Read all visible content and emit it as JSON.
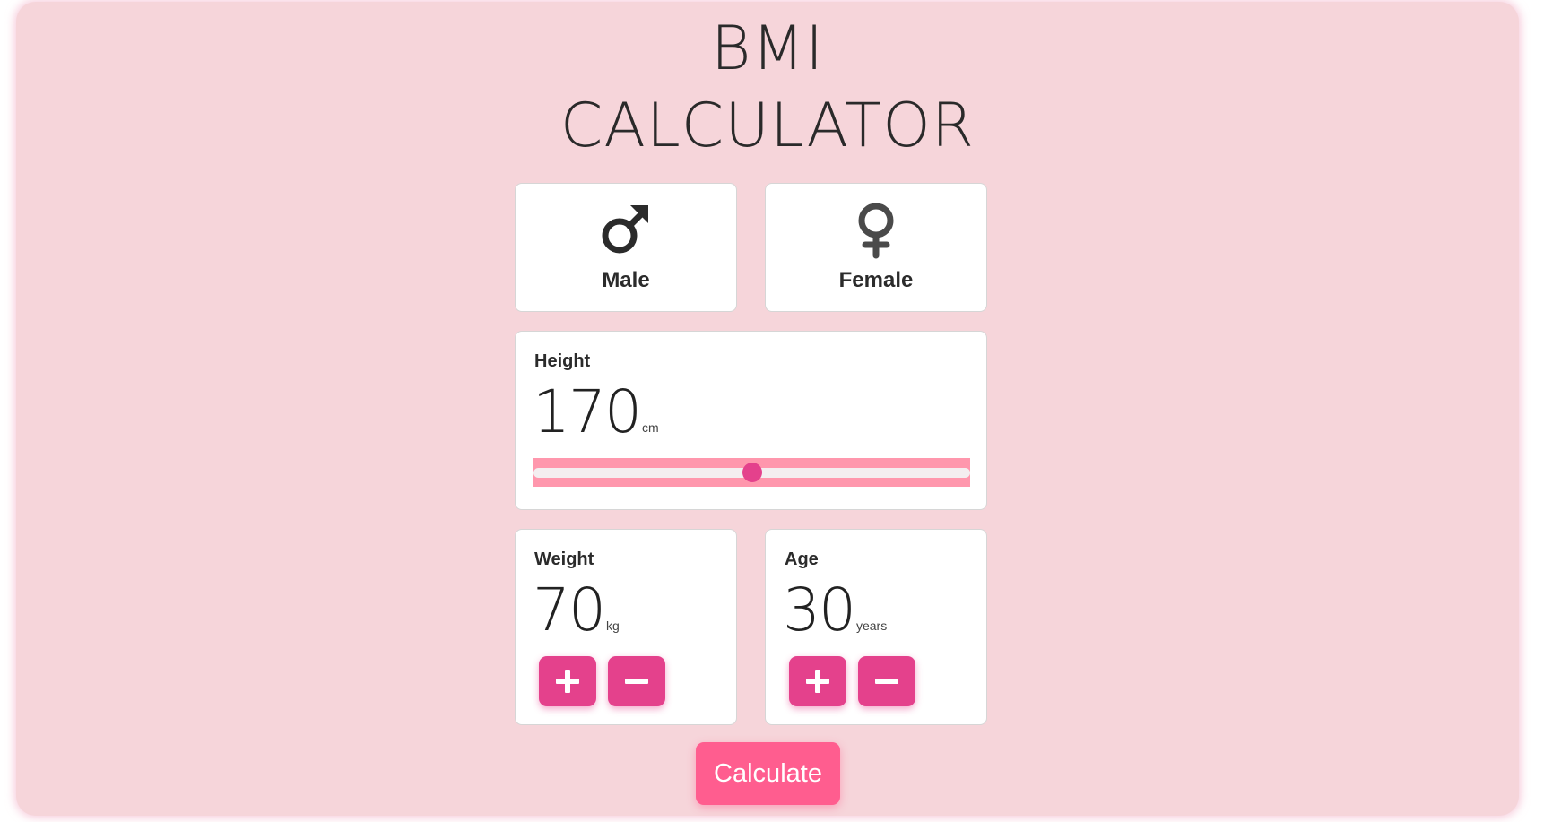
{
  "header": {
    "title_line1": "BMI",
    "title_line2": "CALCULATOR"
  },
  "gender": {
    "male": {
      "label": "Male",
      "icon": "male-symbol-icon"
    },
    "female": {
      "label": "Female",
      "icon": "female-symbol-icon"
    }
  },
  "height": {
    "label": "Height",
    "value": "170",
    "unit": "cm",
    "slider_fraction": 0.5
  },
  "weight": {
    "label": "Weight",
    "value": "70",
    "unit": "kg",
    "plus_icon": "plus-icon",
    "minus_icon": "minus-icon"
  },
  "age": {
    "label": "Age",
    "value": "30",
    "unit": "years",
    "plus_icon": "plus-icon",
    "minus_icon": "minus-icon"
  },
  "actions": {
    "calculate_label": "Calculate"
  },
  "colors": {
    "background": "#f6d5da",
    "accent": "#e4418c",
    "calculate_button": "#ff5d8f",
    "slider_track": "#ff97ad"
  }
}
